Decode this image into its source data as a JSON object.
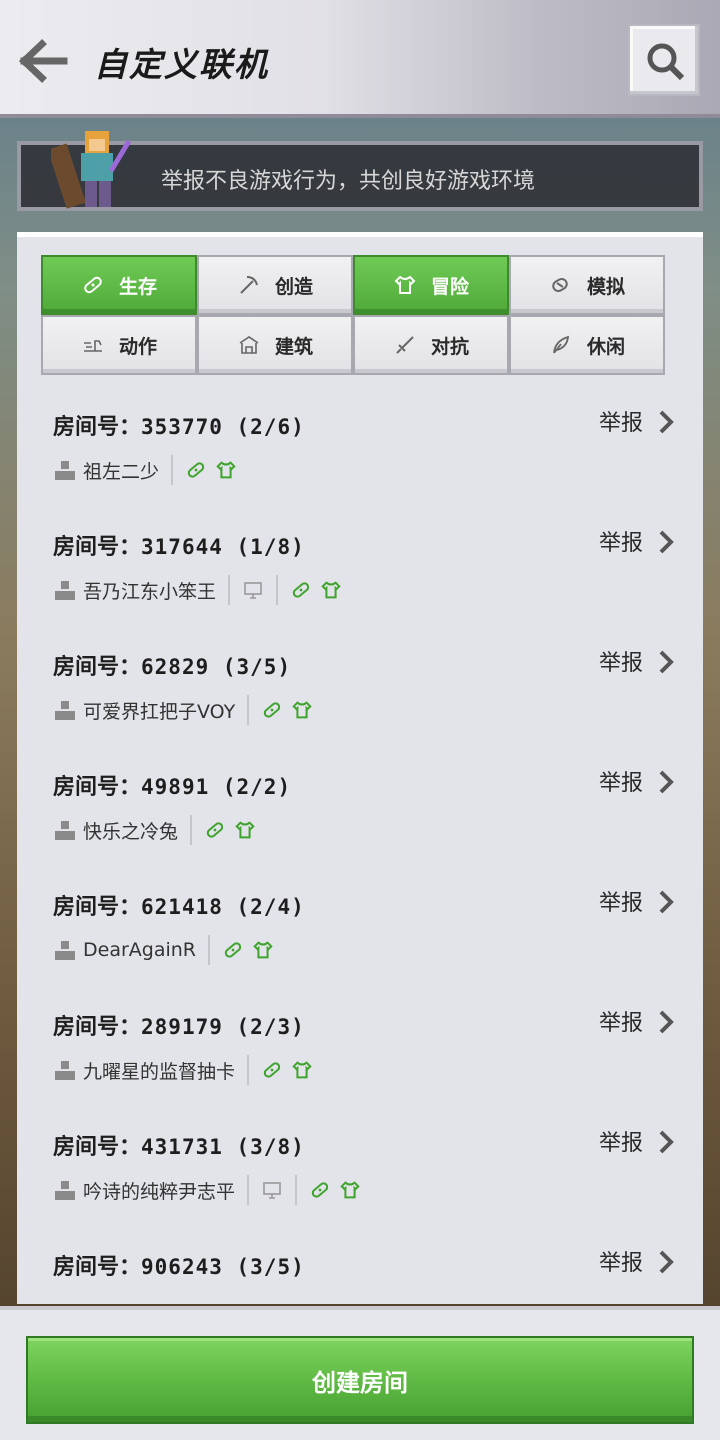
{
  "header": {
    "title": "自定义联机",
    "back_icon": "arrow-left-icon",
    "search_icon": "search-icon"
  },
  "banner": {
    "text": "举报不良游戏行为，共创良好游戏环境"
  },
  "tags": [
    {
      "label": "生存",
      "active": true,
      "icon": "bandage-icon"
    },
    {
      "label": "创造",
      "active": false,
      "icon": "pickaxe-icon"
    },
    {
      "label": "冒险",
      "active": true,
      "icon": "shirt-icon"
    },
    {
      "label": "模拟",
      "active": false,
      "icon": "sim-icon"
    },
    {
      "label": "动作",
      "active": false,
      "icon": "action-icon"
    },
    {
      "label": "建筑",
      "active": false,
      "icon": "building-icon"
    },
    {
      "label": "对抗",
      "active": false,
      "icon": "sword-icon"
    },
    {
      "label": "休闲",
      "active": false,
      "icon": "feather-icon"
    }
  ],
  "room_prefix": "房间号：",
  "report_label": "举报",
  "rooms": [
    {
      "number": "353770 (2/6)",
      "owner": "祖左二少",
      "pc": false
    },
    {
      "number": "317644 (1/8)",
      "owner": "吾乃江东小笨王",
      "pc": true
    },
    {
      "number": "62829 (3/5)",
      "owner": "可爱界扛把子VOY",
      "pc": false
    },
    {
      "number": "49891 (2/2)",
      "owner": "快乐之冷兔",
      "pc": false
    },
    {
      "number": "621418 (2/4)",
      "owner": "DearAgainR",
      "pc": false
    },
    {
      "number": "289179 (2/3)",
      "owner": "九曜星的监督抽卡",
      "pc": false
    },
    {
      "number": "431731 (3/8)",
      "owner": "吟诗的纯粹尹志平",
      "pc": true
    },
    {
      "number": "906243 (3/5)",
      "owner": "",
      "pc": false
    }
  ],
  "create_button": "创建房间"
}
